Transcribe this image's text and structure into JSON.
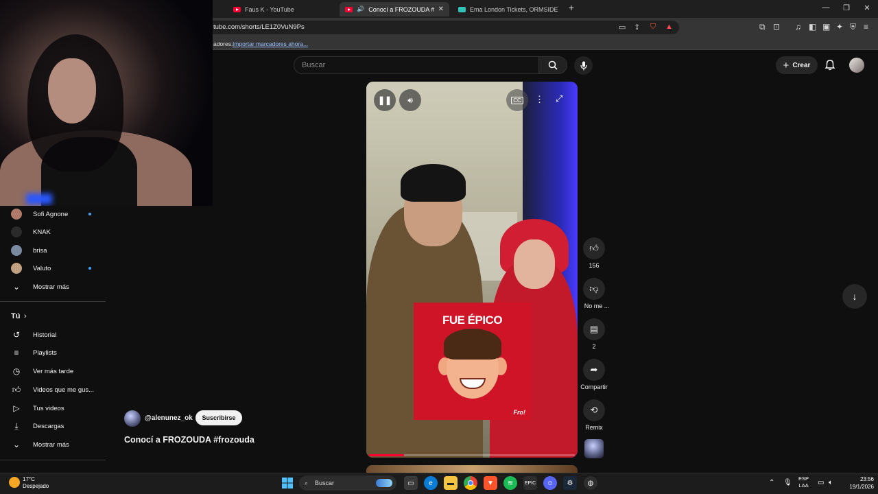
{
  "browser": {
    "tabs": [
      {
        "title": "Faus K - YouTube",
        "active": false
      },
      {
        "title": "Conocí a FROZOUDA #frozou",
        "active": true
      },
      {
        "title": "Ema London Tickets, ORMSIDE PROJ",
        "active": false
      }
    ],
    "new_tab": "+",
    "url": "tube.com/shorts/LE1Z0VuN9Ps",
    "bookmarks_text": "adores.",
    "bookmarks_link": "Importar marcadores ahora..."
  },
  "youtube": {
    "search_placeholder": "Buscar",
    "create_label": "Crear"
  },
  "sidebar": {
    "subscriptions": [
      {
        "name": "Sofi Agnone",
        "dot": true,
        "color": "#b07a6a"
      },
      {
        "name": "KNAK",
        "dot": false,
        "color": "#2a2a2a"
      },
      {
        "name": "brisa",
        "dot": false,
        "color": "#7a8aa0"
      },
      {
        "name": "Valuto",
        "dot": true,
        "color": "#c0a080"
      }
    ],
    "show_more_1": "Mostrar más",
    "you_heading": "Tú",
    "you_items": [
      {
        "label": "Historial",
        "icon": "history-icon"
      },
      {
        "label": "Playlists",
        "icon": "playlists-icon"
      },
      {
        "label": "Ver más tarde",
        "icon": "watch-later-icon"
      },
      {
        "label": "Videos que me gus...",
        "icon": "liked-videos-icon"
      },
      {
        "label": "Tus videos",
        "icon": "your-videos-icon"
      },
      {
        "label": "Descargas",
        "icon": "downloads-icon"
      }
    ],
    "show_more_2": "Mostrar más"
  },
  "short": {
    "meme_title": "FUE ÉPICO",
    "meme_sig": "Fro!",
    "progress": 0.17,
    "channel": "@alenunez_ok",
    "subscribe_label": "Suscribirse",
    "title": "Conocí a FROZOUDA #frozouda",
    "actions": {
      "likes": "156",
      "dislike": "No me ...",
      "comments": "2",
      "share": "Compartir",
      "remix": "Remix"
    }
  },
  "taskbar": {
    "weather_temp": "17°C",
    "weather_desc": "Despejado",
    "search_label": "Buscar",
    "lang_1": "ESP",
    "lang_2": "LAA",
    "time": "23:56",
    "date": "19/1/2026"
  }
}
